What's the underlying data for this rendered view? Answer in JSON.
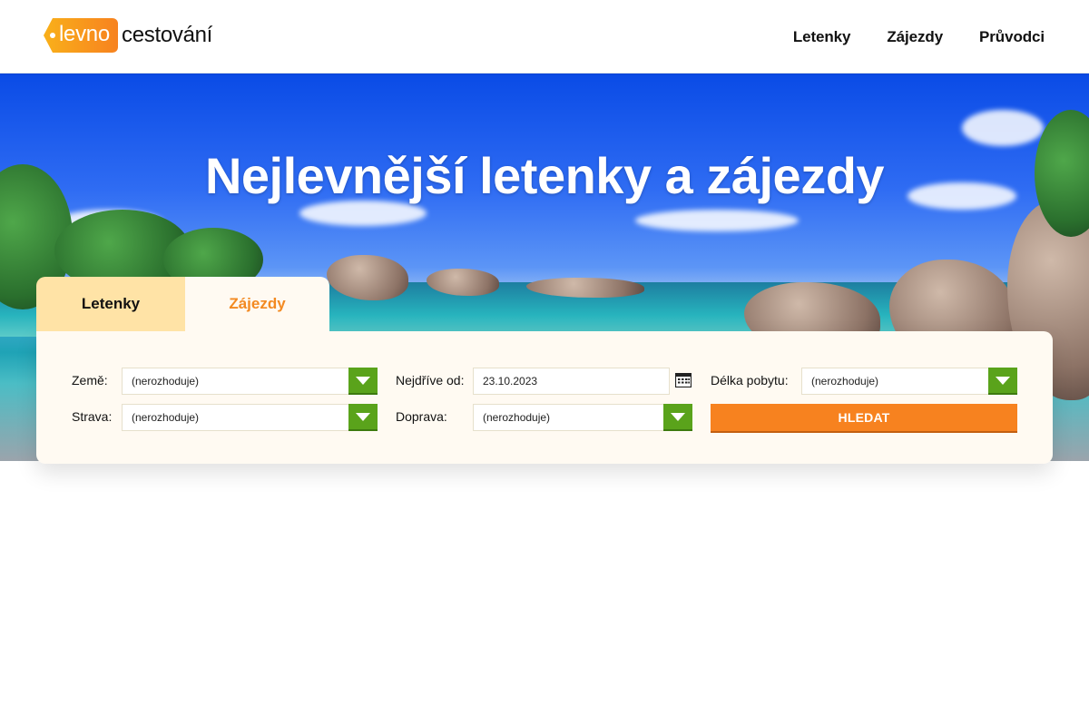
{
  "header": {
    "logo": {
      "tag_text": "levno",
      "word": "cestování"
    },
    "nav": [
      {
        "label": "Letenky"
      },
      {
        "label": "Zájezdy"
      },
      {
        "label": "Průvodci"
      }
    ]
  },
  "hero": {
    "title": "Nejlevnější letenky a zájezdy"
  },
  "search": {
    "tabs": [
      {
        "label": "Letenky",
        "active": false
      },
      {
        "label": "Zájezdy",
        "active": true
      }
    ],
    "fields": {
      "country": {
        "label": "Země:",
        "value": "(nerozhoduje)"
      },
      "board": {
        "label": "Strava:",
        "value": "(nerozhoduje)"
      },
      "earliest_from": {
        "label": "Nejdříve od:",
        "value": "23.10.2023"
      },
      "transport": {
        "label": "Doprava:",
        "value": "(nerozhoduje)"
      },
      "stay_length": {
        "label": "Délka pobytu:",
        "value": "(nerozhoduje)"
      }
    },
    "submit_label": "HLEDAT"
  },
  "colors": {
    "brand_orange": "#f7821f",
    "brand_yellow": "#f9b01a",
    "tab_active_text": "#f38a22",
    "tab_inactive_bg": "#ffe3a6",
    "panel_bg": "#fffaf2",
    "dropdown_green": "#5aa31b"
  },
  "icons": {
    "calendar": "calendar-icon",
    "dropdown": "chevron-down-icon"
  }
}
